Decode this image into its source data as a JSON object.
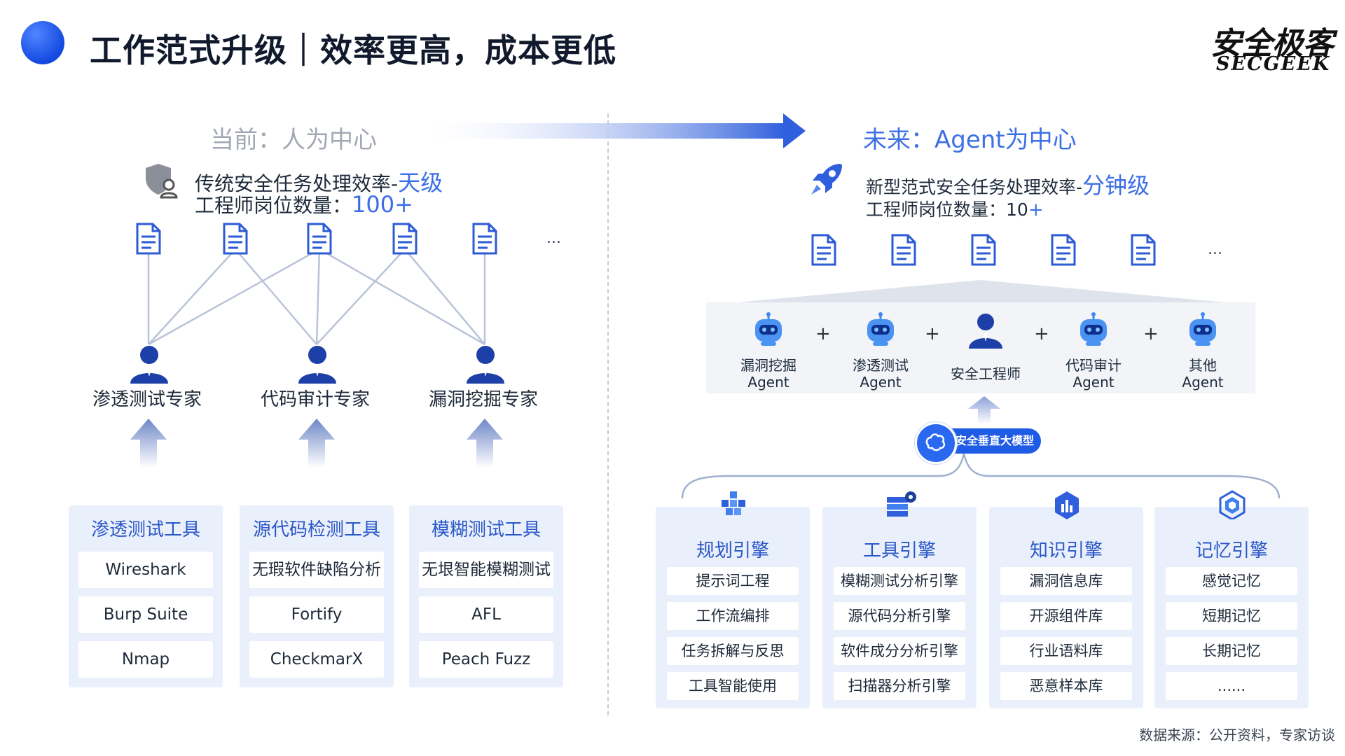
{
  "header": {
    "title": "工作范式升级｜效率更高，成本更低",
    "logo_cn": "安全极客",
    "logo_en": "SECGEEK"
  },
  "left": {
    "section_title": "当前：人为中心",
    "efficiency_prefix": "传统安全任务处理效率-",
    "efficiency_value": "天级",
    "headcount_prefix": "工程师岗位数量：",
    "headcount_value": "100+",
    "ellipsis": "...",
    "experts": [
      "渗透测试专家",
      "代码审计专家",
      "漏洞挖掘专家"
    ],
    "tool_groups": [
      {
        "title": "渗透测试工具",
        "items": [
          "Wireshark",
          "Burp Suite",
          "Nmap"
        ]
      },
      {
        "title": "源代码检测工具",
        "items": [
          "无瑕软件缺陷分析",
          "Fortify",
          "CheckmarX"
        ]
      },
      {
        "title": "模糊测试工具",
        "items": [
          "无垠智能模糊测试",
          "AFL",
          "Peach Fuzz"
        ]
      }
    ]
  },
  "right": {
    "section_title": "未来：Agent为中心",
    "efficiency_prefix": "新型范式安全任务处理效率-",
    "efficiency_value": "分钟级",
    "headcount_prefix": "工程师岗位数量：",
    "headcount_value": "10",
    "headcount_plus": "+",
    "ellipsis": "...",
    "plus": "+",
    "agents": [
      {
        "line1": "漏洞挖掘",
        "line2": "Agent"
      },
      {
        "line1": "渗透测试",
        "line2": "Agent"
      },
      {
        "line1": "安全工程师",
        "line2": ""
      },
      {
        "line1": "代码审计",
        "line2": "Agent"
      },
      {
        "line1": "其他",
        "line2": "Agent"
      }
    ],
    "model_label": "安全垂直大模型",
    "engines": [
      {
        "title": "规划引擎",
        "icon": "planning-icon",
        "items": [
          "提示词工程",
          "工作流编排",
          "任务拆解与反思",
          "工具智能使用"
        ]
      },
      {
        "title": "工具引擎",
        "icon": "tool-gear-icon",
        "items": [
          "模糊测试分析引擎",
          "源代码分析引擎",
          "软件成分分析引擎",
          "扫描器分析引擎"
        ]
      },
      {
        "title": "知识引擎",
        "icon": "knowledge-icon",
        "items": [
          "漏洞信息库",
          "开源组件库",
          "行业语料库",
          "恶意样本库"
        ]
      },
      {
        "title": "记忆引擎",
        "icon": "memory-icon",
        "items": [
          "感觉记忆",
          "短期记忆",
          "长期记忆",
          "......"
        ]
      }
    ]
  },
  "footer": {
    "source": "数据来源：公开资料，专家访谈"
  },
  "colors": {
    "accent": "#3c6fe6",
    "card_bg": "#eaf0fb",
    "muted": "#a2a8b4",
    "person": "#1c3fa8"
  }
}
